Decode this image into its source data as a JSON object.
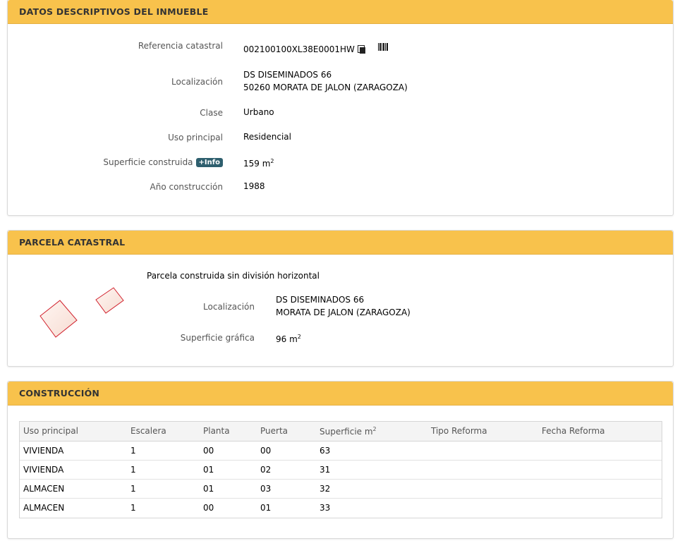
{
  "datos": {
    "title": "DATOS DESCRIPTIVOS DEL INMUEBLE",
    "referencia_label": "Referencia catastral",
    "referencia_value": "002100100XL38E0001HW",
    "localizacion_label": "Localización",
    "localizacion_line1": "DS DISEMINADOS 66",
    "localizacion_line2": "50260 MORATA DE JALON (ZARAGOZA)",
    "clase_label": "Clase",
    "clase_value": "Urbano",
    "uso_label": "Uso principal",
    "uso_value": "Residencial",
    "superficie_label": "Superficie construida",
    "info_badge": "+Info",
    "superficie_value": "159 m",
    "superficie_unit_sup": "2",
    "anio_label": "Año construcción",
    "anio_value": "1988"
  },
  "parcela": {
    "title": "PARCELA CATASTRAL",
    "descripcion": "Parcela construida sin división horizontal",
    "localizacion_label": "Localización",
    "localizacion_line1": "DS DISEMINADOS 66",
    "localizacion_line2": "MORATA DE JALON (ZARAGOZA)",
    "superficie_label": "Superficie gráfica",
    "superficie_value": "96 m",
    "superficie_unit_sup": "2"
  },
  "construccion": {
    "title": "CONSTRUCCIÓN",
    "headers": [
      "Uso principal",
      "Escalera",
      "Planta",
      "Puerta",
      "Superficie m",
      "Tipo Reforma",
      "Fecha Reforma"
    ],
    "superficie_header_sup": "2",
    "rows": [
      [
        "VIVIENDA",
        "1",
        "00",
        "00",
        "63",
        "",
        ""
      ],
      [
        "VIVIENDA",
        "1",
        "01",
        "02",
        "31",
        "",
        ""
      ],
      [
        "ALMACEN",
        "1",
        "01",
        "03",
        "32",
        "",
        ""
      ],
      [
        "ALMACEN",
        "1",
        "00",
        "01",
        "33",
        "",
        ""
      ]
    ]
  }
}
